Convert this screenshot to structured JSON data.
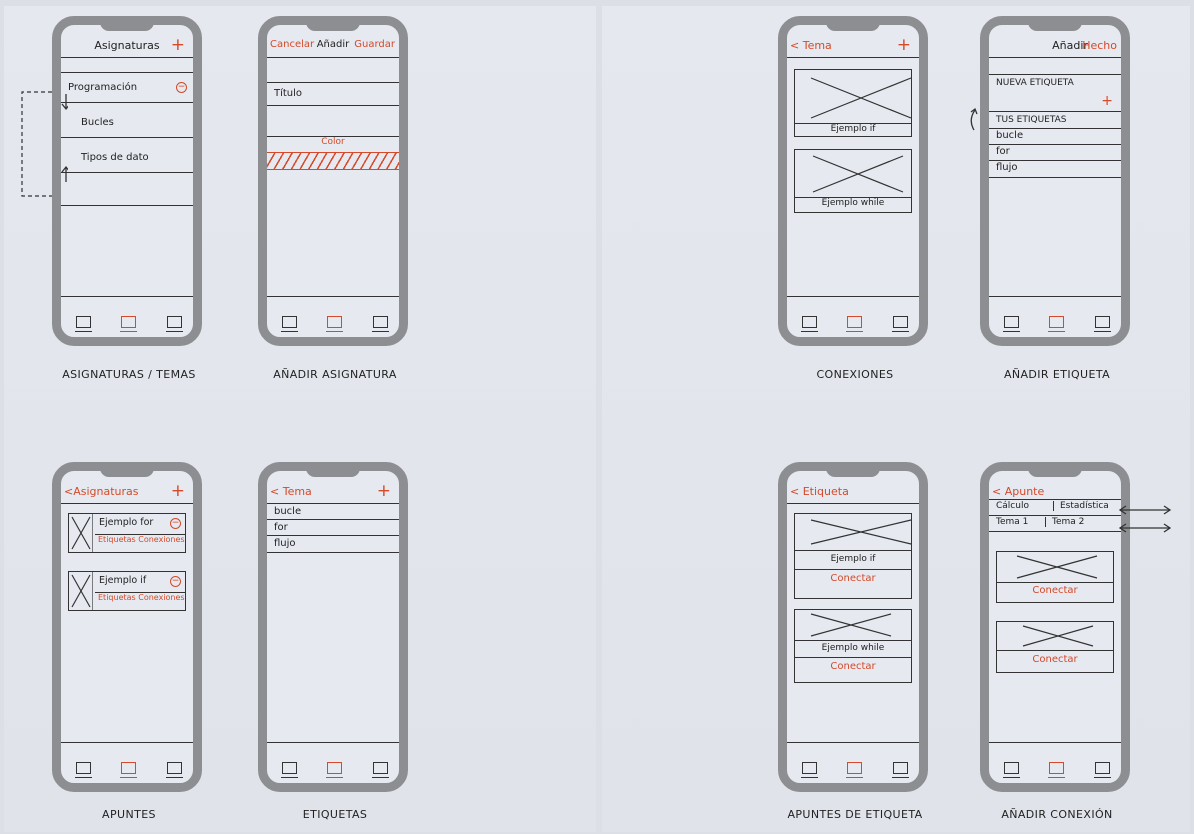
{
  "captions": {
    "asignaturas_temas": "ASIGNATURAS / TEMAS",
    "anadir_asignatura": "AÑADIR ASIGNATURA",
    "conexiones": "CONEXIONES",
    "anadir_etiqueta": "AÑADIR ETIQUETA",
    "apuntes": "APUNTES",
    "etiquetas": "ETIQUETAS",
    "apuntes_de_etiqueta": "APUNTES DE ETIQUETA",
    "anadir_conexion": "AÑADIR CONEXIÓN"
  },
  "screens": {
    "asignaturas": {
      "title": "Asignaturas",
      "plus": "+",
      "rows": [
        "Programación",
        "Bucles",
        "Tipos de dato"
      ]
    },
    "anadir_asignatura": {
      "cancel": "Cancelar",
      "title": "Añadir",
      "save": "Guardar",
      "field": "Título",
      "color": "Color"
    },
    "conexiones": {
      "back": "< Tema",
      "plus": "+",
      "cards": [
        "Ejemplo if",
        "Ejemplo while"
      ]
    },
    "anadir_etiqueta": {
      "title": "Añadir",
      "done": "Hecho",
      "new_tag": "NUEVA ETIQUETA",
      "plus": "+",
      "your_tags": "TUS ETIQUETAS",
      "tags": [
        "bucle",
        "for",
        "flujo"
      ]
    },
    "apuntes": {
      "back": "<Asignaturas",
      "plus": "+",
      "notes": [
        {
          "title": "Ejemplo for",
          "links": "Etiquetas Conexiones"
        },
        {
          "title": "Ejemplo if",
          "links": "Etiquetas Conexiones"
        }
      ]
    },
    "etiquetas": {
      "back": "< Tema",
      "plus": "+",
      "tags": [
        "bucle",
        "for",
        "flujo"
      ]
    },
    "apuntes_etiqueta": {
      "back": "< Etiqueta",
      "cards": [
        {
          "title": "Ejemplo if",
          "action": "Conectar"
        },
        {
          "title": "Ejemplo while",
          "action": "Conectar"
        }
      ]
    },
    "anadir_conexion": {
      "back": "< Apunte",
      "subjects": [
        "Cálculo",
        "Estadística"
      ],
      "topics": [
        "Tema 1",
        "Tema 2"
      ],
      "actions": [
        "Conectar",
        "Conectar"
      ]
    }
  },
  "colors": {
    "accent": "#d44a2a",
    "frame": "#8c8e91",
    "ink": "#333333",
    "paper": "#e5e8ef"
  }
}
